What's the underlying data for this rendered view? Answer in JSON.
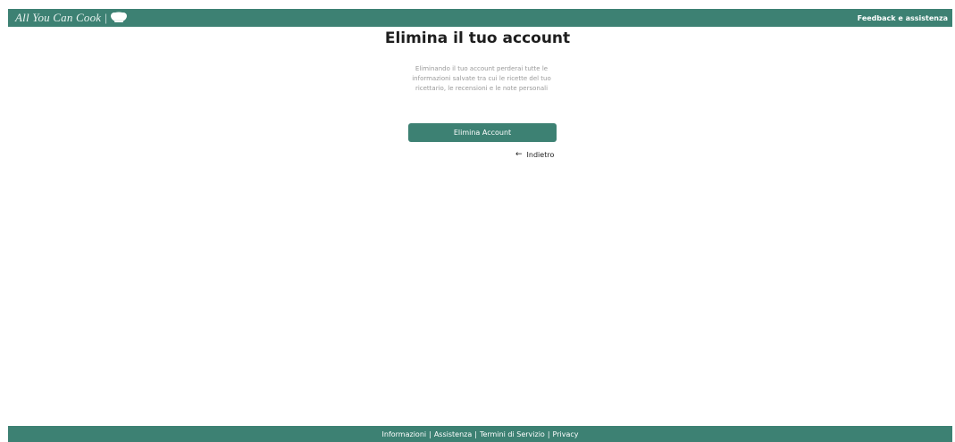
{
  "header": {
    "brand_name": "All You Can Cook",
    "brand_separator": "|",
    "brand_icon": "chef-hat-icon",
    "feedback_label": "Feedback e assistenza"
  },
  "main": {
    "title": "Elimina il tuo account",
    "warning_text": "Eliminando il tuo account perderai tutte le informazioni salvate tra cui le ricette del tuo ricettario, le recensioni e le note personali",
    "delete_button_label": "Elimina Account",
    "back_arrow": "←",
    "back_label": "Indietro"
  },
  "footer": {
    "links": [
      "Informazioni",
      "Assistenza",
      "Termini di Servizio",
      "Privacy"
    ],
    "separator": "|"
  },
  "colors": {
    "brand_green": "#3d8173",
    "background": "#ffffff"
  }
}
